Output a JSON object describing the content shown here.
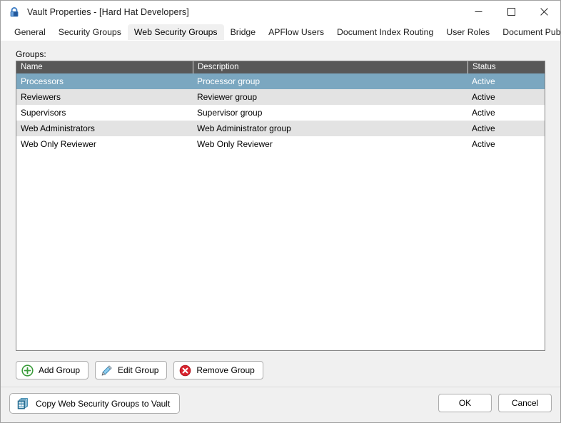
{
  "window": {
    "title": "Vault Properties - [Hard Hat Developers]",
    "icon": "lock-icon",
    "controls": {
      "minimize": "minimize-icon",
      "maximize": "maximize-icon",
      "close": "close-icon"
    }
  },
  "tabs": [
    {
      "label": "General",
      "active": false
    },
    {
      "label": "Security Groups",
      "active": false
    },
    {
      "label": "Web Security Groups",
      "active": true
    },
    {
      "label": "Bridge",
      "active": false
    },
    {
      "label": "APFlow Users",
      "active": false
    },
    {
      "label": "Document Index Routing",
      "active": false
    },
    {
      "label": "User Roles",
      "active": false
    },
    {
      "label": "Document Publishing",
      "active": false
    }
  ],
  "main": {
    "groups_label": "Groups:",
    "columns": [
      "Name",
      "Description",
      "Status"
    ],
    "rows": [
      {
        "name": "Processors",
        "description": "Processor group",
        "status": "Active",
        "selected": true,
        "alt": false
      },
      {
        "name": "Reviewers",
        "description": "Reviewer group",
        "status": "Active",
        "selected": false,
        "alt": true
      },
      {
        "name": "Supervisors",
        "description": "Supervisor group",
        "status": "Active",
        "selected": false,
        "alt": false
      },
      {
        "name": "Web Administrators",
        "description": "Web Administrator group",
        "status": "Active",
        "selected": false,
        "alt": true
      },
      {
        "name": "Web Only Reviewer",
        "description": "Web Only Reviewer",
        "status": "Active",
        "selected": false,
        "alt": false
      }
    ],
    "actions": [
      {
        "label": "Add Group",
        "icon": "add-circle-icon"
      },
      {
        "label": "Edit Group",
        "icon": "pencil-icon"
      },
      {
        "label": "Remove Group",
        "icon": "delete-circle-icon"
      }
    ]
  },
  "footer": {
    "copy_label": "Copy Web Security Groups to Vault",
    "copy_icon": "copy-documents-icon",
    "ok_label": "OK",
    "cancel_label": "Cancel"
  },
  "colors": {
    "selection": "#7ba7c0",
    "header_bar": "#585858",
    "alt_row": "#e3e3e3",
    "dialog_bg": "#f0f0f0",
    "add_green": "#3a9b3a",
    "remove_red": "#d9232e",
    "pencil_blue": "#63b4e0",
    "copy_blue": "#2d7fa8",
    "lock_blue": "#2f6fb5"
  }
}
